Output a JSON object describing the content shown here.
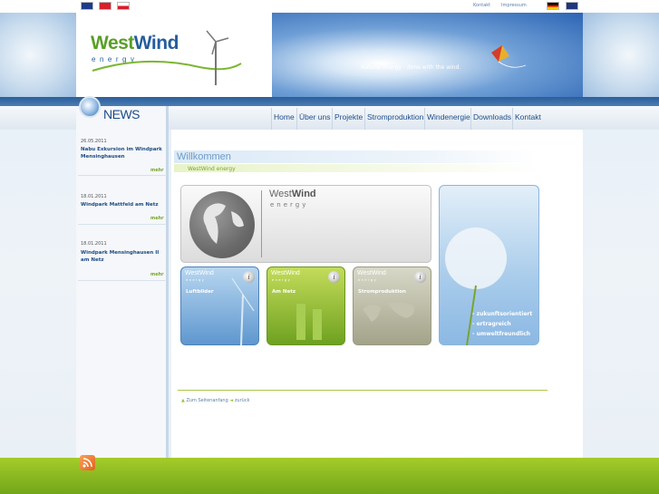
{
  "topbar": {
    "links": [
      "Kontakt",
      "Impressum"
    ]
  },
  "brand": {
    "logo_west": "West",
    "logo_wind": "Wind",
    "logo_energy": "energy",
    "slogan": "Natural energy - done with the wind."
  },
  "nav": {
    "items": [
      "Home",
      "Über uns",
      "Projekte",
      "Stromproduktion",
      "Windenergie",
      "Downloads",
      "Kontakt"
    ]
  },
  "news": {
    "title": "NEWS",
    "items": [
      {
        "date": "26.05.2011",
        "headline": "Nabu Exkursion im Windpark Mensinghausen",
        "more": "mehr"
      },
      {
        "date": "18.01.2011",
        "headline": "Windpark Mattfeld am Netz",
        "more": "mehr"
      },
      {
        "date": "18.01.2011",
        "headline": "Windpark Mensinghausen II am Netz",
        "more": "mehr"
      }
    ]
  },
  "main": {
    "welcome": "Willkommen",
    "subtitle": "WestWind energy",
    "bigbox_west": "West",
    "bigbox_wind": "Wind",
    "bigbox_energy": "energy",
    "tiles": [
      {
        "logo": "WestWind",
        "energy": "energy",
        "label": "Luftbilder"
      },
      {
        "logo": "WestWind",
        "energy": "energy",
        "label": "Am Netz"
      },
      {
        "logo": "WestWind",
        "energy": "energy",
        "label": "Stromproduktion"
      }
    ],
    "dandelion_lines": [
      "- zukunftsorientiert",
      "- ertragreich",
      "- umweltfreundlich"
    ],
    "bottom_top": "Zum Seitenanfang",
    "bottom_back": "zurück"
  },
  "colors": {
    "brand_blue": "#245d9c",
    "brand_green": "#5a9f28",
    "footer_green": "#8fbd22"
  }
}
